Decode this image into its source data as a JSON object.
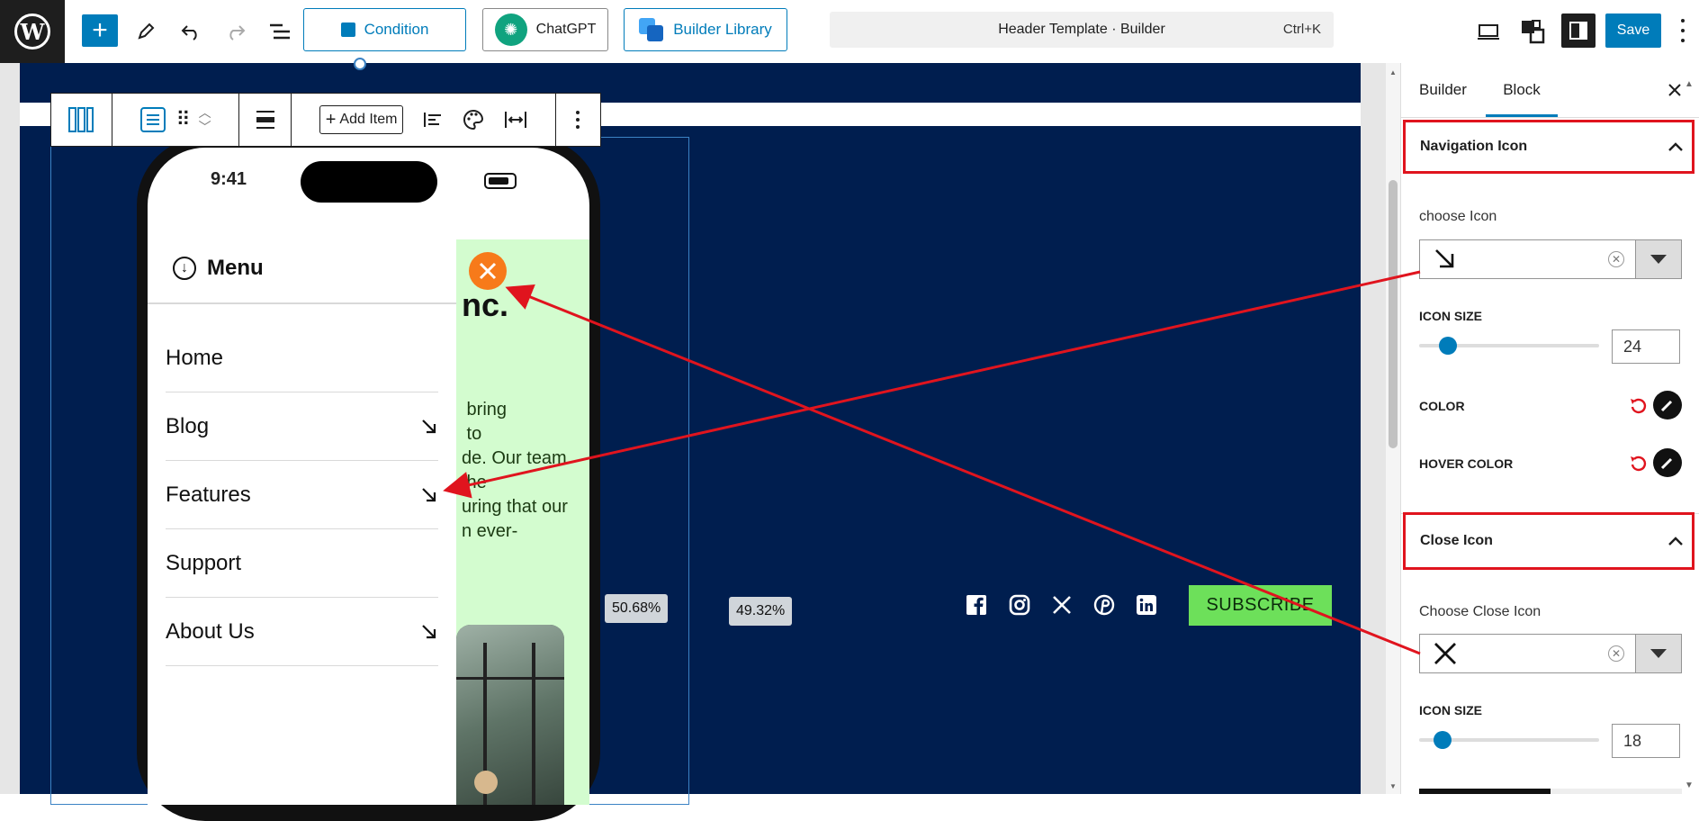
{
  "toolbar": {
    "condition_label": "Condition",
    "chatgpt_label": "ChatGPT",
    "library_label": "Builder Library",
    "command_title": "Header Template · Builder",
    "command_shortcut": "Ctrl+K",
    "save_label": "Save"
  },
  "block_toolbar": {
    "add_item_label": "Add Item"
  },
  "phone": {
    "time": "9:41",
    "menu_label": "Menu",
    "nav_items": [
      {
        "label": "Home",
        "arrow": false
      },
      {
        "label": "Blog",
        "arrow": true
      },
      {
        "label": "Features",
        "arrow": true
      },
      {
        "label": "Support",
        "arrow": false
      },
      {
        "label": "About Us",
        "arrow": true
      }
    ],
    "bg_heading": "nc.",
    "bg_text": " bring\n to\nde. Our team\nthe\nuring that our\nn ever-"
  },
  "canvas": {
    "width_left": "50.68%",
    "width_right": "49.32%",
    "subscribe_label": "SUBSCRIBE",
    "social_icons": [
      "facebook-icon",
      "instagram-icon",
      "x-icon",
      "pinterest-icon",
      "linkedin-icon"
    ]
  },
  "sidebar": {
    "tabs": [
      "Builder",
      "Block"
    ],
    "active_tab": "Block",
    "navigation_icon": {
      "title": "Navigation Icon",
      "choose_label": "choose Icon",
      "size_label": "ICON SIZE",
      "size_value": "24",
      "color_label": "COLOR",
      "hover_color_label": "HOVER COLOR"
    },
    "close_icon": {
      "title": "Close Icon",
      "choose_label": "Choose Close Icon",
      "size_label": "ICON SIZE",
      "size_value": "18"
    }
  },
  "colors": {
    "accent": "#007cba",
    "navy": "#001e4f",
    "highlight": "#e0141e",
    "subscribe": "#6de05a",
    "close_button": "#f77a1a"
  }
}
